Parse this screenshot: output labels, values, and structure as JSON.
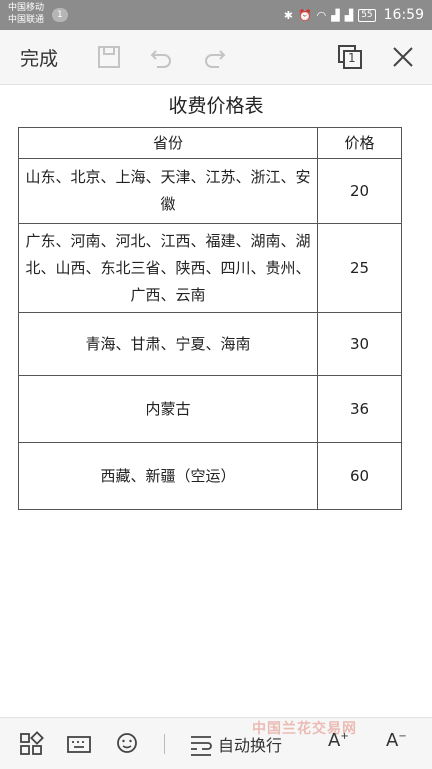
{
  "status_bar": {
    "carrier1": "中国移动",
    "carrier2": "中国联通",
    "notification_count": "1",
    "battery": "55",
    "time": "16:59",
    "icons": [
      "bluetooth-icon",
      "alarm-icon",
      "wifi-icon",
      "signal-icon",
      "signal-icon",
      "battery-icon"
    ]
  },
  "toolbar": {
    "done_label": "完成",
    "icons": [
      "save-icon",
      "undo-icon",
      "redo-icon",
      "page-switch-icon",
      "close-icon"
    ],
    "page_switch_number": "1"
  },
  "document": {
    "title": "收费价格表",
    "columns": [
      "省份",
      "价格"
    ],
    "rows": [
      {
        "provinces": "山东、北京、上海、天津、江苏、浙江、安徽",
        "price": "20"
      },
      {
        "provinces": "广东、河南、河北、江西、福建、湖南、湖北、山西、东北三省、陕西、四川、贵州、广西、云南",
        "price": "25"
      },
      {
        "provinces": "青海、甘肃、宁夏、海南",
        "price": "30"
      },
      {
        "provinces": "内蒙古",
        "price": "36"
      },
      {
        "provinces": "西藏、新疆（空运）",
        "price": "60"
      }
    ]
  },
  "bottom_bar": {
    "wrap_label": "自动换行",
    "font_increase": "A",
    "font_decrease": "A",
    "icons": [
      "apps-grid-icon",
      "keyboard-icon",
      "emoji-icon",
      "text-wrap-icon"
    ]
  },
  "watermark": "中国兰花交易网"
}
